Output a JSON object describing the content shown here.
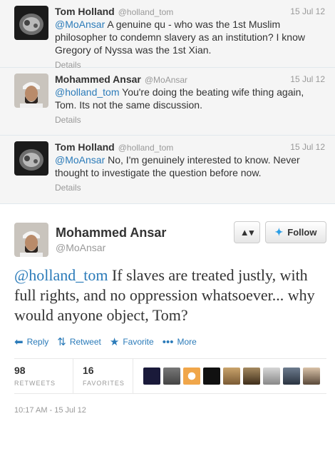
{
  "replies": [
    {
      "fullname": "Tom Holland",
      "username": "@holland_tom",
      "time": "15 Jul 12",
      "mention": "@MoAnsar",
      "text": " A genuine qu - who was the 1st Muslim philosopher to condemn slavery as an institution? I know Gregory of Nyssa was the 1st Xian.",
      "details": "Details"
    },
    {
      "fullname": "Mohammed Ansar",
      "username": "@MoAnsar",
      "time": "15 Jul 12",
      "mention": "@holland_tom",
      "text": " You're doing the beating wife thing again, Tom. Its not the same discussion.",
      "details": "Details"
    },
    {
      "fullname": "Tom Holland",
      "username": "@holland_tom",
      "time": "15 Jul 12",
      "mention": "@MoAnsar",
      "text": " No, I'm genuinely interested to know. Never thought to investigate the question before now.",
      "details": "Details"
    }
  ],
  "main": {
    "fullname": "Mohammed Ansar",
    "username": "@MoAnsar",
    "follow_label": "Follow",
    "mention": "@holland_tom",
    "text": " If slaves are treated justly, with full rights, and no oppression whatsoever... why would anyone object, Tom?",
    "actions": {
      "reply": "Reply",
      "retweet": "Retweet",
      "favorite": "Favorite",
      "more": "More"
    },
    "stats": {
      "retweets_count": "98",
      "retweets_label": "RETWEETS",
      "favorites_count": "16",
      "favorites_label": "FAVORITES"
    },
    "timestamp": "10:17 AM - 15 Jul 12"
  },
  "colors": {
    "link": "#2b7bb9",
    "muted": "#999999",
    "reply_bg": "#f5f5f5"
  }
}
